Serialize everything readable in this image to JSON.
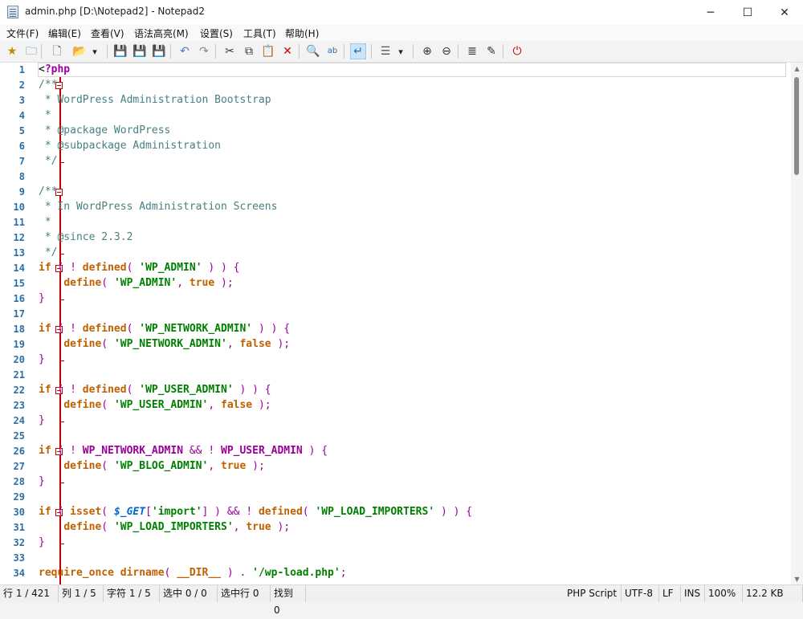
{
  "window": {
    "title": "admin.php [D:\\Notepad2] - Notepad2",
    "minimize": "─",
    "maximize": "☐",
    "close": "✕"
  },
  "menu": [
    "文件(F)",
    "编辑(E)",
    "查看(V)",
    "语法高亮(M)",
    "设置(S)",
    "工具(T)",
    "帮助(H)"
  ],
  "toolbar": {
    "icons": [
      {
        "name": "favorites-icon",
        "glyph": "★",
        "color": "#c08a00"
      },
      {
        "name": "browse-icon",
        "glyph": "🗀",
        "color": "#2a6ea6"
      },
      {
        "name": "new-file-icon",
        "glyph": "🗋",
        "color": "#555555"
      },
      {
        "name": "open-file-icon",
        "glyph": "📂",
        "color": "#c08a00"
      },
      {
        "name": "open-dropdown-icon",
        "glyph": "▾",
        "color": "#222222"
      },
      {
        "name": "save-icon",
        "glyph": "💾",
        "color": "#2a6ea6"
      },
      {
        "name": "save-as-icon",
        "glyph": "💾",
        "color": "#2a6ea6"
      },
      {
        "name": "save-all-icon",
        "glyph": "💾",
        "color": "#2a6ea6"
      },
      {
        "name": "undo-icon",
        "glyph": "↶",
        "color": "#4a7cc4"
      },
      {
        "name": "redo-icon",
        "glyph": "↷",
        "color": "#888888"
      },
      {
        "name": "cut-icon",
        "glyph": "✂",
        "color": "#333333"
      },
      {
        "name": "copy-icon",
        "glyph": "⧉",
        "color": "#333333"
      },
      {
        "name": "paste-icon",
        "glyph": "📋",
        "color": "#999999"
      },
      {
        "name": "delete-icon",
        "glyph": "✕",
        "color": "#cc0000"
      },
      {
        "name": "find-icon",
        "glyph": "🔍",
        "color": "#2a6ea6"
      },
      {
        "name": "replace-icon",
        "glyph": "ab",
        "color": "#2a6ea6"
      },
      {
        "name": "word-wrap-icon",
        "glyph": "↵",
        "color": "#2a6ea6"
      },
      {
        "name": "code-folding-icon",
        "glyph": "☰",
        "color": "#555555"
      },
      {
        "name": "folding-dropdown-icon",
        "glyph": "▾",
        "color": "#222222"
      },
      {
        "name": "zoom-in-icon",
        "glyph": "⊕",
        "color": "#333333"
      },
      {
        "name": "zoom-out-icon",
        "glyph": "⊖",
        "color": "#333333"
      },
      {
        "name": "scheme-icon",
        "glyph": "≣",
        "color": "#333333"
      },
      {
        "name": "settings-icon",
        "glyph": "✎",
        "color": "#333333"
      },
      {
        "name": "exit-icon",
        "glyph": "⏻",
        "color": "#cc0000"
      }
    ]
  },
  "editor": {
    "lines": [
      [
        [
          "<",
          "c-plain"
        ],
        [
          "?php",
          "c-tag"
        ]
      ],
      [
        [
          "/**",
          "c-comment"
        ]
      ],
      [
        [
          " * WordPress Administration Bootstrap",
          "c-comment"
        ]
      ],
      [
        [
          " *",
          "c-comment"
        ]
      ],
      [
        [
          " * @package WordPress",
          "c-comment"
        ]
      ],
      [
        [
          " * @subpackage Administration",
          "c-comment"
        ]
      ],
      [
        [
          " */",
          "c-comment"
        ]
      ],
      [],
      [
        [
          "/**",
          "c-comment"
        ]
      ],
      [
        [
          " * In WordPress Administration Screens",
          "c-comment"
        ]
      ],
      [
        [
          " *",
          "c-comment"
        ]
      ],
      [
        [
          " * @since 2.3.2",
          "c-comment"
        ]
      ],
      [
        [
          " */",
          "c-comment"
        ]
      ],
      [
        [
          "if",
          "c-kw"
        ],
        [
          " ( ! ",
          "c-pun"
        ],
        [
          "defined",
          "c-kw"
        ],
        [
          "( ",
          "c-pun"
        ],
        [
          "'WP_ADMIN'",
          "c-str"
        ],
        [
          " ) ) {",
          "c-pun"
        ]
      ],
      [
        [
          "    ",
          "c-plain"
        ],
        [
          "define",
          "c-kw"
        ],
        [
          "( ",
          "c-pun"
        ],
        [
          "'WP_ADMIN'",
          "c-str"
        ],
        [
          ", ",
          "c-pun"
        ],
        [
          "true",
          "c-kw"
        ],
        [
          " );",
          "c-pun"
        ]
      ],
      [
        [
          "}",
          "c-brace"
        ]
      ],
      [],
      [
        [
          "if",
          "c-kw"
        ],
        [
          " ( ! ",
          "c-pun"
        ],
        [
          "defined",
          "c-kw"
        ],
        [
          "( ",
          "c-pun"
        ],
        [
          "'WP_NETWORK_ADMIN'",
          "c-str"
        ],
        [
          " ) ) {",
          "c-pun"
        ]
      ],
      [
        [
          "    ",
          "c-plain"
        ],
        [
          "define",
          "c-kw"
        ],
        [
          "( ",
          "c-pun"
        ],
        [
          "'WP_NETWORK_ADMIN'",
          "c-str"
        ],
        [
          ", ",
          "c-pun"
        ],
        [
          "false",
          "c-kw"
        ],
        [
          " );",
          "c-pun"
        ]
      ],
      [
        [
          "}",
          "c-brace"
        ]
      ],
      [],
      [
        [
          "if",
          "c-kw"
        ],
        [
          " ( ! ",
          "c-pun"
        ],
        [
          "defined",
          "c-kw"
        ],
        [
          "( ",
          "c-pun"
        ],
        [
          "'WP_USER_ADMIN'",
          "c-str"
        ],
        [
          " ) ) {",
          "c-pun"
        ]
      ],
      [
        [
          "    ",
          "c-plain"
        ],
        [
          "define",
          "c-kw"
        ],
        [
          "( ",
          "c-pun"
        ],
        [
          "'WP_USER_ADMIN'",
          "c-str"
        ],
        [
          ", ",
          "c-pun"
        ],
        [
          "false",
          "c-kw"
        ],
        [
          " );",
          "c-pun"
        ]
      ],
      [
        [
          "}",
          "c-brace"
        ]
      ],
      [],
      [
        [
          "if",
          "c-kw"
        ],
        [
          " ( ! ",
          "c-pun"
        ],
        [
          "WP_NETWORK_ADMIN",
          "c-const"
        ],
        [
          " && ! ",
          "c-pun"
        ],
        [
          "WP_USER_ADMIN",
          "c-const"
        ],
        [
          " ) {",
          "c-pun"
        ]
      ],
      [
        [
          "    ",
          "c-plain"
        ],
        [
          "define",
          "c-kw"
        ],
        [
          "( ",
          "c-pun"
        ],
        [
          "'WP_BLOG_ADMIN'",
          "c-str"
        ],
        [
          ", ",
          "c-pun"
        ],
        [
          "true",
          "c-kw"
        ],
        [
          " );",
          "c-pun"
        ]
      ],
      [
        [
          "}",
          "c-brace"
        ]
      ],
      [],
      [
        [
          "if",
          "c-kw"
        ],
        [
          " ( ",
          "c-pun"
        ],
        [
          "isset",
          "c-kw"
        ],
        [
          "( ",
          "c-pun"
        ],
        [
          "$_GET",
          "c-var"
        ],
        [
          "[",
          "c-pun"
        ],
        [
          "'import'",
          "c-str"
        ],
        [
          "] ) && ! ",
          "c-pun"
        ],
        [
          "defined",
          "c-kw"
        ],
        [
          "( ",
          "c-pun"
        ],
        [
          "'WP_LOAD_IMPORTERS'",
          "c-str"
        ],
        [
          " ) ) {",
          "c-pun"
        ]
      ],
      [
        [
          "    ",
          "c-plain"
        ],
        [
          "define",
          "c-kw"
        ],
        [
          "( ",
          "c-pun"
        ],
        [
          "'WP_LOAD_IMPORTERS'",
          "c-str"
        ],
        [
          ", ",
          "c-pun"
        ],
        [
          "true",
          "c-kw"
        ],
        [
          " );",
          "c-pun"
        ]
      ],
      [
        [
          "}",
          "c-brace"
        ]
      ],
      [],
      [
        [
          "require_once",
          "c-kw"
        ],
        [
          " ",
          "c-plain"
        ],
        [
          "dirname",
          "c-kw"
        ],
        [
          "( ",
          "c-pun"
        ],
        [
          "__DIR__",
          "c-kw"
        ],
        [
          " ) . ",
          "c-pun"
        ],
        [
          "'/wp-load.php'",
          "c-str"
        ],
        [
          ";",
          "c-pun"
        ]
      ]
    ]
  },
  "status": [
    "行 1 / 421",
    "列 1 / 5",
    "字符 1 / 5",
    "选中 0 / 0",
    "选中行 0",
    "找到 0",
    "PHP Script",
    "UTF-8",
    "LF",
    "INS",
    "100%",
    "12.2 KB"
  ]
}
